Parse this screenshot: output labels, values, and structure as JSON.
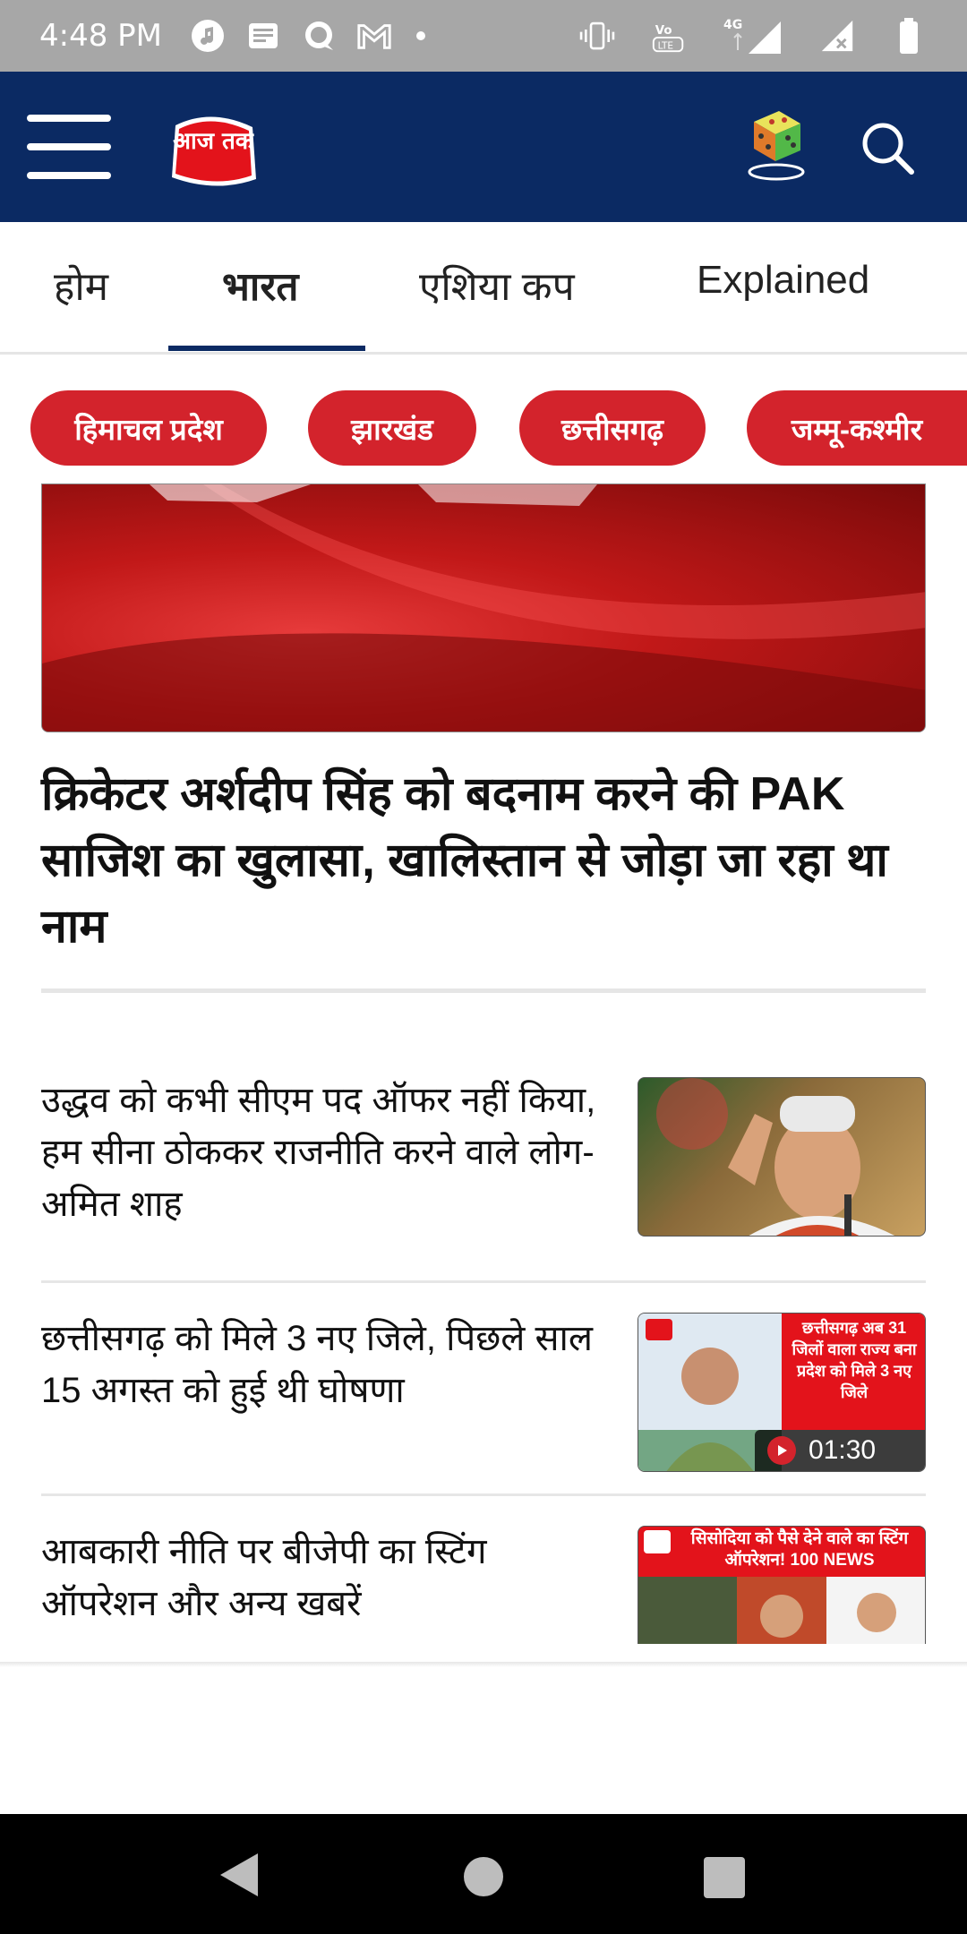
{
  "status_bar": {
    "time": "4:48 PM",
    "icons": [
      "music-icon",
      "news-icon",
      "chat-icon",
      "gmail-icon",
      "dot-icon",
      "vibrate-icon",
      "volte-icon",
      "4g-signal-icon",
      "signal-icon",
      "battery-icon"
    ],
    "network": "4G"
  },
  "app_bar": {
    "logo_text": "आज तक",
    "icons": [
      "menu-icon",
      "dice-icon",
      "search-icon"
    ]
  },
  "tabs": [
    {
      "label": "होम"
    },
    {
      "label": "भारत"
    },
    {
      "label": "एशिया कप"
    },
    {
      "label": "Explained"
    }
  ],
  "active_tab": "भारत",
  "chips": [
    {
      "label": "हिमाचल प्रदेश"
    },
    {
      "label": "झारखंड"
    },
    {
      "label": "छत्तीसगढ़"
    },
    {
      "label": "जम्मू-कश्मीर"
    }
  ],
  "hero": {
    "title": "क्रिकेटर अर्शदीप सिंह को बदनाम करने की PAK साजिश का खुलासा, खालिस्तान से जोड़ा जा रहा था नाम"
  },
  "articles": [
    {
      "title": "उद्धव को कभी सीएम पद ऑफर नहीं किया, हम सीना ठोककर राजनीति करने वाले लोग- अमित शाह"
    },
    {
      "title": "छत्तीसगढ़ को मिले 3 नए जिले, पिछले साल 15 अगस्त को हुई थी घोषणा",
      "thumb_text": "छत्तीसगढ़ अब 31 जिलों वाला राज्य बना प्रदेश को मिले 3 नए जिले",
      "duration": "01:30"
    },
    {
      "title": "आबकारी नीति पर बीजेपी का स्टिंग ऑपरेशन और अन्य खबरें",
      "thumb_text": "सिसोदिया को पैसे देने वाले का स्टिंग ऑपरेशन! 100 NEWS"
    }
  ],
  "colors": {
    "header_bg": "#0b2a63",
    "chip_bg": "#d3232c",
    "status_bg": "#a7a7a7"
  }
}
